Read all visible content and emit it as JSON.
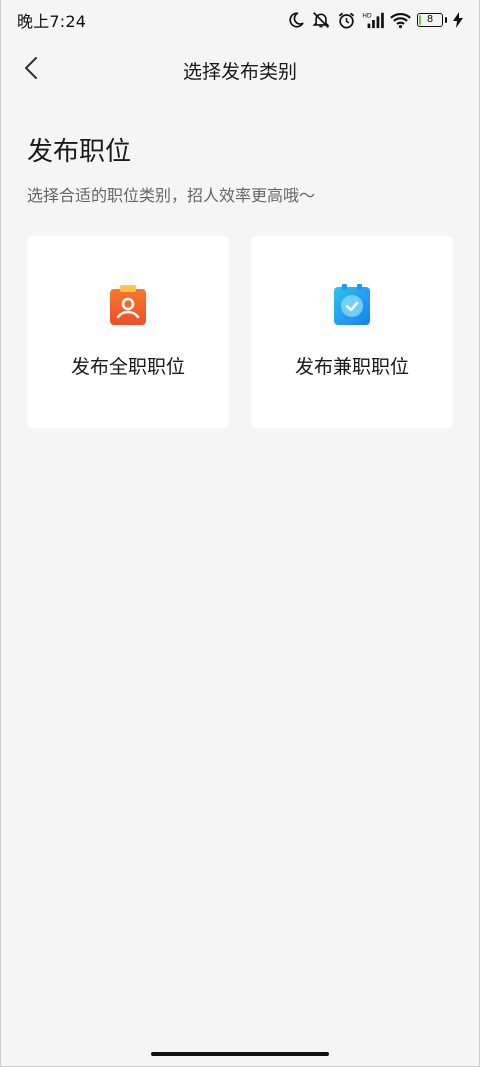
{
  "status_bar": {
    "time": "晚上7:24",
    "hd_label": "HD",
    "battery_level": "8",
    "battery_fraction": 0.08,
    "icons": [
      "moon-icon",
      "mute-icon",
      "alarm-icon",
      "signal-icon",
      "wifi-icon",
      "battery-icon",
      "charging-icon"
    ]
  },
  "nav": {
    "title": "选择发布类别",
    "back_icon": "chevron-left-icon"
  },
  "content": {
    "title": "发布职位",
    "subtitle": "选择合适的职位类别，招人效率更高哦～",
    "cards": [
      {
        "label": "发布全职职位",
        "icon": "fulltime-badge-icon",
        "color": "#f5622a"
      },
      {
        "label": "发布兼职职位",
        "icon": "parttime-clock-icon",
        "color": "#1e9bf0"
      }
    ]
  },
  "colors": {
    "background": "#f5f5f5",
    "card": "#ffffff",
    "battery_fill": "#7ac143"
  }
}
